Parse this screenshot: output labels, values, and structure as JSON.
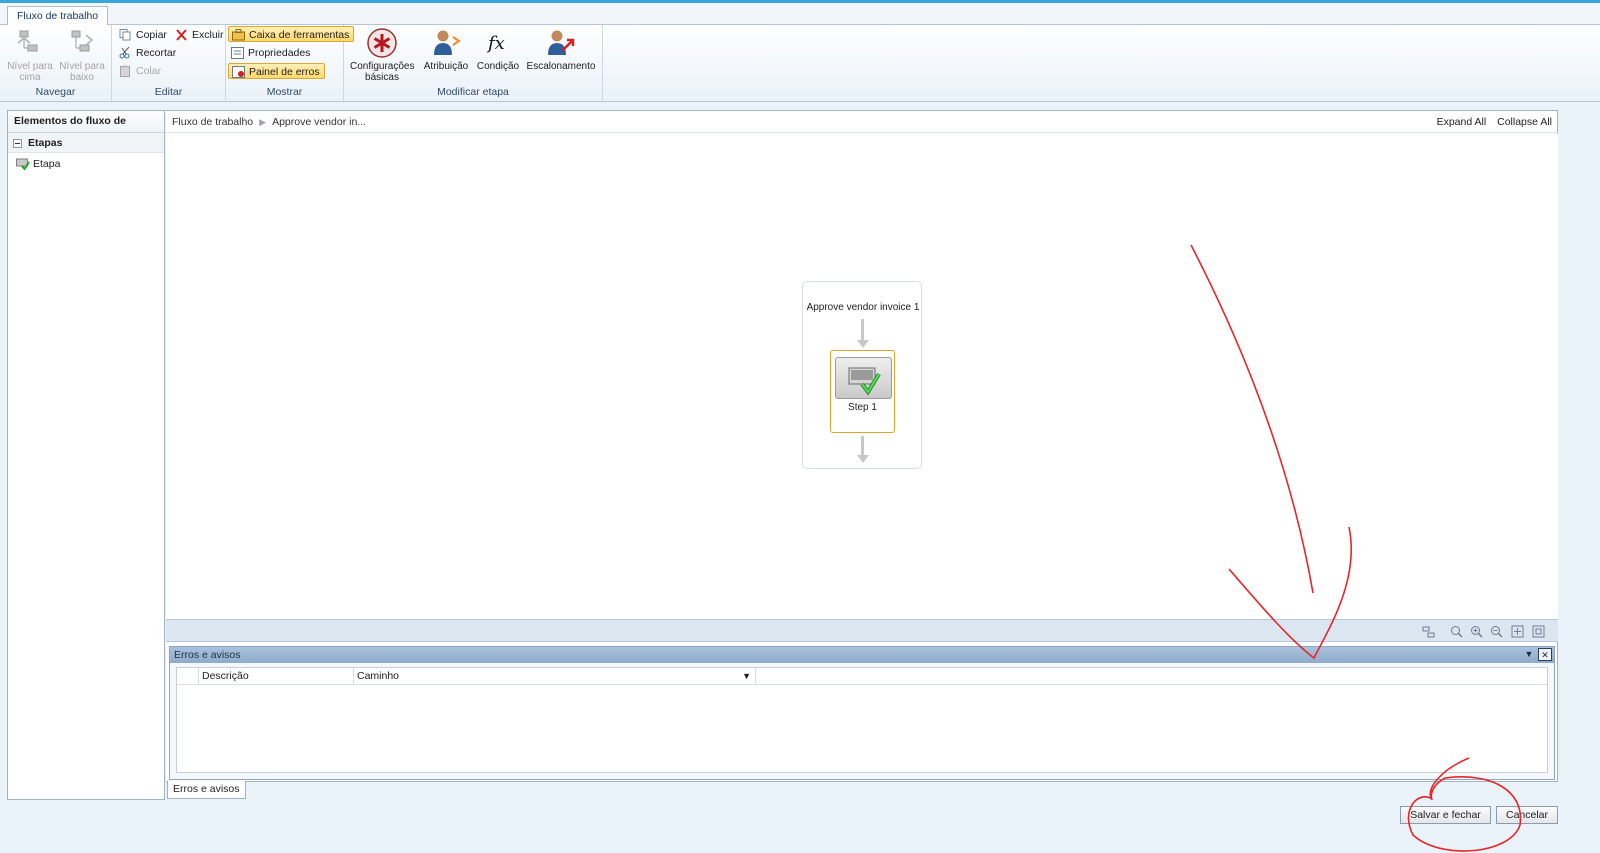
{
  "ribbon": {
    "tab": "Fluxo de trabalho",
    "groups": {
      "navegar": {
        "label": "Navegar",
        "level_up": "Nível para cima",
        "level_down": "Nível para baixo"
      },
      "editar": {
        "label": "Editar",
        "copy": "Copiar",
        "delete": "Excluir",
        "cut": "Recortar",
        "paste": "Colar"
      },
      "mostrar": {
        "label": "Mostrar",
        "toolbox": "Caixa de ferramentas",
        "properties": "Propriedades",
        "error_pane": "Painel de erros"
      },
      "modificar": {
        "label": "Modificar etapa",
        "basic_settings": "Configurações básicas",
        "assignment": "Atribuição",
        "condition": "Condição",
        "escalation": "Escalonamento"
      }
    }
  },
  "left_pane": {
    "header": "Elementos do fluxo de trabalho",
    "section": "Etapas",
    "items": [
      "Etapa"
    ]
  },
  "breadcrumb": {
    "root": "Fluxo de trabalho",
    "current": "Approve vendor in...",
    "expand_all": "Expand All",
    "collapse_all": "Collapse All"
  },
  "workflow": {
    "title": "Approve vendor invoice 1",
    "step_label": "Step 1"
  },
  "errors_panel": {
    "title": "Erros e avisos",
    "columns": [
      "Descrição",
      "Caminho"
    ],
    "tab_label": "Erros e avisos"
  },
  "buttons": {
    "save_close": "Salvar e fechar",
    "cancel": "Cancelar"
  },
  "colors": {
    "accent": "#36a7d9",
    "step_border": "#e1a32a",
    "annotation": "#e8262a"
  }
}
